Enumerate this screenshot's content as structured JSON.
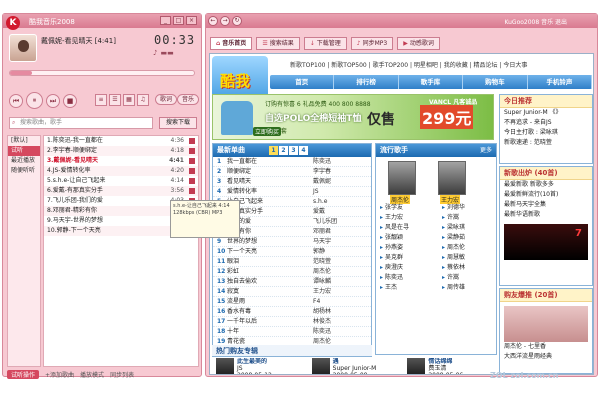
{
  "player": {
    "title": "酷我音乐2008",
    "window_buttons": [
      "_",
      "□",
      "×"
    ],
    "now_playing": "戴佩妮-看见晴天 [4:41]",
    "time": "00:33",
    "progress": 0.12,
    "controls": [
      "⏮",
      "⏸",
      "⏭",
      "■"
    ],
    "pill_a": "歌词",
    "pill_b": "音乐",
    "search_placeholder": "搜索歌曲，歌手",
    "search_button": "搜索下载",
    "categories": [
      {
        "label": "[默认]",
        "active": false
      },
      {
        "label": "试听",
        "active": true
      },
      {
        "label": "最近播放",
        "active": false
      },
      {
        "label": "随便听听",
        "active": false
      }
    ],
    "songs": [
      {
        "title": "1.陈奕迅-我一直都在",
        "dur": "4:36",
        "current": false
      },
      {
        "title": "2.李宇春-顺便绑定",
        "dur": "4:18",
        "current": false
      },
      {
        "title": "3.戴佩妮-看见晴天",
        "dur": "4:41",
        "current": true
      },
      {
        "title": "4.JS-爱情转化率",
        "dur": "4:20",
        "current": false
      },
      {
        "title": "5.s.h.e-让自己飞起来",
        "dur": "4:14",
        "current": false
      },
      {
        "title": "6.爱戴-有那真实分手",
        "dur": "3:56",
        "current": false
      },
      {
        "title": "7.飞儿乐团-我们的爱",
        "dur": "4:03",
        "current": false
      },
      {
        "title": "8.邓丽君-精彩有你",
        "dur": "3:31",
        "current": false
      },
      {
        "title": "9.马天宇-世界的梦想",
        "dur": "4:08",
        "current": false
      },
      {
        "title": "10.郭静-下一个天亮",
        "dur": "4:02",
        "current": false
      }
    ],
    "tooltip": "s.h.e-让自己飞起来 4:14 128kbps (CBR) MP3",
    "bottom": {
      "main": "试听操作",
      "add": "+添加歌曲",
      "mode": "播放模式",
      "sync": "同步列表"
    }
  },
  "browser": {
    "nav_buttons": [
      "←",
      "→",
      "↻"
    ],
    "user_text": "KuGoo2008 音乐 退出",
    "tabs": [
      {
        "icon": "⌂",
        "label": "音乐首页",
        "active": true
      },
      {
        "icon": "☰",
        "label": "搜索结果",
        "active": false
      },
      {
        "icon": "↓",
        "label": "下载管理",
        "active": false
      },
      {
        "icon": "♪",
        "label": "同步MP3",
        "active": false
      },
      {
        "icon": "▶",
        "label": "动感歌词",
        "active": false
      }
    ],
    "logo_text": "酷我",
    "top_links": "新歌TOP100 | 新歌TOP500 | 歌手TOP200 | 明星相吧 | 我的收藏 | 精品论坛 | 今日大事",
    "nav": [
      "首页",
      "排行榜",
      "歌手库",
      "购物车",
      "手机铃声"
    ],
    "banner": {
      "line1": "订购有惊喜 6 礼品免费 400 800 8888",
      "line2": "自选POLO全棉短袖T恤",
      "line3": "4件套",
      "price_prefix": "仅售",
      "price": "299元",
      "brand": "VANCL 凡客诚品",
      "button": "立即购买"
    },
    "new_songs": {
      "title": "最新单曲",
      "pages": [
        "1",
        "2",
        "3",
        "4"
      ],
      "rows": [
        {
          "n": "1",
          "song": "我一直都在",
          "artist": "陈奕迅"
        },
        {
          "n": "2",
          "song": "顺便绑定",
          "artist": "李宇春"
        },
        {
          "n": "3",
          "song": "看见晴天",
          "artist": "戴佩妮"
        },
        {
          "n": "4",
          "song": "爱情转化率",
          "artist": "JS"
        },
        {
          "n": "5",
          "song": "让自己飞起来",
          "artist": "s.h.e"
        },
        {
          "n": "6",
          "song": "有那真实分手",
          "artist": "爱戴"
        },
        {
          "n": "7",
          "song": "我们的爱",
          "artist": "飞儿乐团"
        },
        {
          "n": "8",
          "song": "精彩有你",
          "artist": "邓丽君"
        },
        {
          "n": "9",
          "song": "世界的梦想",
          "artist": "马天宇"
        },
        {
          "n": "10",
          "song": "下一个天亮",
          "artist": "郭静"
        },
        {
          "n": "11",
          "song": "眼泪",
          "artist": "范晓萱"
        },
        {
          "n": "12",
          "song": "彩虹",
          "artist": "周杰伦"
        },
        {
          "n": "13",
          "song": "独自去偷欢",
          "artist": "谭咏麟"
        },
        {
          "n": "14",
          "song": "寂寞",
          "artist": "王力宏"
        },
        {
          "n": "15",
          "song": "流星雨",
          "artist": "F4"
        },
        {
          "n": "16",
          "song": "香水有毒",
          "artist": "胡杨林"
        },
        {
          "n": "17",
          "song": "一千年以后",
          "artist": "林俊杰"
        },
        {
          "n": "18",
          "song": "十年",
          "artist": "陈奕迅"
        },
        {
          "n": "19",
          "song": "青花瓷",
          "artist": "周杰伦"
        }
      ]
    },
    "singers": {
      "title": "流行歌手",
      "more": "更多",
      "photo_labels": [
        "周杰伦",
        "王力宏"
      ],
      "rows": [
        {
          "a": "张学友",
          "b": "刘德华"
        },
        {
          "a": "王力宏",
          "b": "许嵩"
        },
        {
          "a": "风是在寻",
          "b": "梁咏琪"
        },
        {
          "a": "张靓颖",
          "b": "梁静茹"
        },
        {
          "a": "孙燕姿",
          "b": "周杰伦"
        },
        {
          "a": "吴克群",
          "b": "周慧敏"
        },
        {
          "a": "庾澄庆",
          "b": "蔡依林"
        },
        {
          "a": "陈奕迅",
          "b": "许嵩"
        },
        {
          "a": "王杰",
          "b": "周传雄"
        }
      ]
    },
    "top_recommend": {
      "title": "今日推荐",
      "rows": [
        "Super Junior-M 《》",
        "不再追求 - 来自JS",
        "今日主打歌 : 梁咏琪",
        "新歌速递 : 范晓萱"
      ]
    },
    "new_hits": {
      "title": "新歌出炉",
      "count": "(40首)",
      "rows": [
        "最爱新歌 新歌多多",
        "最爱新鲜流行(10首)",
        "最新马天宇全集",
        "最新华语新歌"
      ],
      "image_text": "7"
    },
    "chart_picks": {
      "title": "购友爆推",
      "count": "(20首)",
      "rows": [
        "周杰伦 - 七里香",
        "大西洋流星雨经典"
      ]
    },
    "albums": {
      "title": "热门购友专辑",
      "items": [
        {
          "name": "此生最美的",
          "artist": "JS",
          "date": "2008-05-12"
        },
        {
          "name": "遇",
          "artist": "Super Junior-M",
          "date": "2008-05-09"
        },
        {
          "name": "情话绵绵",
          "artist": "费玉清",
          "date": "2008-05-06"
        }
      ]
    },
    "watermark": "ZOL zol.com.cn"
  }
}
